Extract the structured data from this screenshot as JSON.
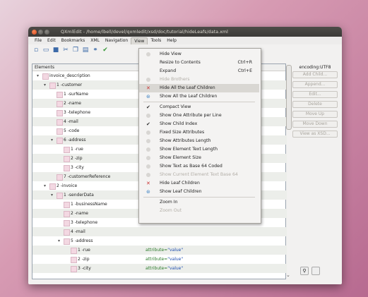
{
  "window": {
    "title": "QXmlEdit - /home/lbell/devel/qxmledit/xsd/doc/tutorial/hideLeafs/data.xml"
  },
  "menubar": [
    {
      "label": "File"
    },
    {
      "label": "Edit"
    },
    {
      "label": "Bookmarks"
    },
    {
      "label": "XML"
    },
    {
      "label": "Navigation"
    },
    {
      "label": "View"
    },
    {
      "label": "Tools"
    },
    {
      "label": "Help"
    }
  ],
  "toolbar": [
    "new-icon",
    "open-icon",
    "save-icon",
    "cut-icon",
    "copy-icon",
    "paste-icon",
    "find-icon",
    "valid-icon"
  ],
  "tree": {
    "header": "Elements",
    "rows": [
      {
        "label": "invoice_description",
        "depth": 0,
        "exp": "▾"
      },
      {
        "label": "1 -customer",
        "depth": 1,
        "exp": "▾"
      },
      {
        "label": "1 -surName",
        "depth": 2
      },
      {
        "label": "2 -name",
        "depth": 2
      },
      {
        "label": "3 -telephone",
        "depth": 2
      },
      {
        "label": "4 -mail",
        "depth": 2
      },
      {
        "label": "5 -code",
        "depth": 2
      },
      {
        "label": "6 -address",
        "depth": 2,
        "exp": "▾"
      },
      {
        "label": "1 -rue",
        "depth": 3
      },
      {
        "label": "2 -zip",
        "depth": 3
      },
      {
        "label": "3 -city",
        "depth": 3
      },
      {
        "label": "7 -customerReference",
        "depth": 2
      },
      {
        "label": "2 -invoice",
        "depth": 1,
        "exp": "▾"
      },
      {
        "label": "1 -senderData",
        "depth": 2,
        "exp": "▾"
      },
      {
        "label": "1 -businessName",
        "depth": 3
      },
      {
        "label": "2 -name",
        "depth": 3
      },
      {
        "label": "3 -telephone",
        "depth": 3
      },
      {
        "label": "4 -mail",
        "depth": 3
      },
      {
        "label": "5 -address",
        "depth": 3,
        "exp": "▾"
      },
      {
        "label": "1 -rue",
        "depth": 4,
        "attr": "attribute=",
        "val": "\"value\""
      },
      {
        "label": "2 -zip",
        "depth": 4,
        "attr": "attribute=",
        "val": "\"value\""
      },
      {
        "label": "3 -city",
        "depth": 4,
        "attr": "attribute=",
        "val": "\"value\""
      }
    ]
  },
  "side": {
    "encoding": "encoding:UTF8",
    "buttons": [
      "Add Child...",
      "Append...",
      "Edit...",
      "Delete",
      "Move Up",
      "Move Down",
      "View as XSD..."
    ]
  },
  "view_menu": {
    "items": [
      {
        "label": "Hide View",
        "icon": "dim"
      },
      {
        "label": "Resize to Contents",
        "shortcut": "Ctrl+R"
      },
      {
        "label": "Expand",
        "shortcut": "Ctrl+E"
      },
      {
        "label": "Hide Brothers",
        "disabled": true,
        "icon": "dim"
      },
      {
        "label": "Hide All the Leaf Children",
        "icon": "x",
        "highlight": true
      },
      {
        "label": "Show All the Leaf Children",
        "icon": "show"
      },
      {
        "sep": true
      },
      {
        "label": "Compact View",
        "icon": "check"
      },
      {
        "label": "Show One Attribute per Line",
        "icon": "dim"
      },
      {
        "label": "Show Child Index",
        "icon": "check"
      },
      {
        "label": "Fixed Size Attributes",
        "icon": "dim"
      },
      {
        "label": "Show Attributes Length",
        "icon": "dim"
      },
      {
        "label": "Show Element Text Length",
        "icon": "dim"
      },
      {
        "label": "Show Element Size",
        "icon": "dim"
      },
      {
        "label": "Show Text as Base 64 Coded",
        "icon": "dim"
      },
      {
        "label": "Show Current Element Text Base 64",
        "disabled": true,
        "icon": "dim"
      },
      {
        "label": "Hide Leaf Children",
        "icon": "x"
      },
      {
        "label": "Show Leaf Children",
        "icon": "show"
      },
      {
        "sep": true
      },
      {
        "label": "Zoom In"
      },
      {
        "label": "Zoom Out",
        "disabled": true
      }
    ]
  }
}
